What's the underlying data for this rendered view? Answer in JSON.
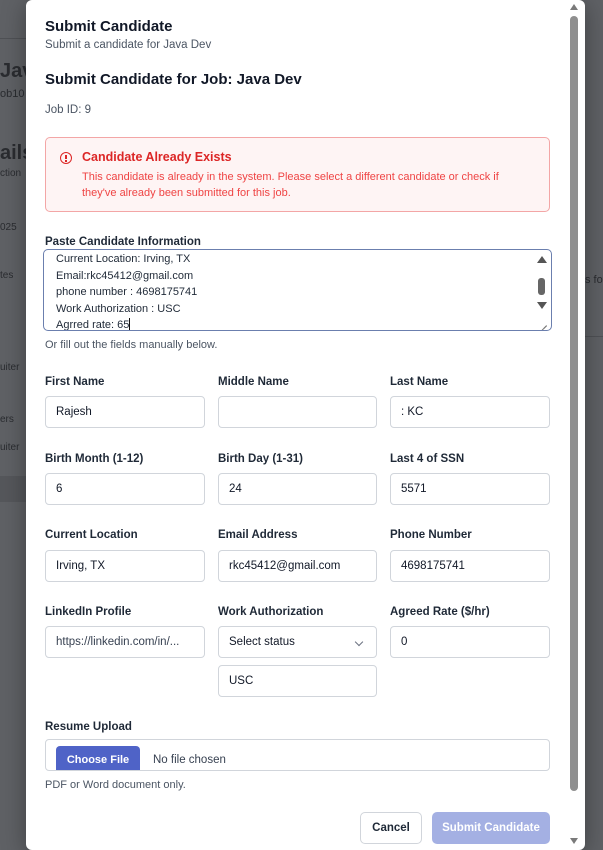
{
  "background": {
    "fragments": [
      "Java",
      "ob10",
      "ails",
      "ction",
      "025",
      "tes",
      "uiter",
      "ers",
      "uiter",
      "s fo"
    ]
  },
  "modal": {
    "title": "Submit Candidate",
    "subtitle": "Submit a candidate for Java Dev",
    "heading": "Submit Candidate for Job: Java Dev",
    "job_id": "Job ID: 9"
  },
  "alert": {
    "icon": "alert-circle-icon",
    "title": "Candidate Already Exists",
    "message": "This candidate is already in the system. Please select a different candidate or check if they've already been submitted for this job.",
    "color": "#dc2626"
  },
  "paste": {
    "label": "Paste Candidate Information",
    "lines": [
      "Current Location: Irving, TX",
      "Email:rkc45412@gmail.com",
      "phone number : 4698175741",
      "Work Authorization : USC",
      "Agrred rate: 65"
    ],
    "hint": "Or fill out the fields manually below."
  },
  "fields": {
    "first_name": {
      "label": "First Name",
      "value": "Rajesh"
    },
    "middle_name": {
      "label": "Middle Name",
      "value": ""
    },
    "last_name": {
      "label": "Last Name",
      "value": ": KC"
    },
    "birth_month": {
      "label": "Birth Month (1-12)",
      "value": "6"
    },
    "birth_day": {
      "label": "Birth Day (1-31)",
      "value": "24"
    },
    "ssn_last4": {
      "label": "Last 4 of SSN",
      "value": "5571"
    },
    "location": {
      "label": "Current Location",
      "value": "Irving, TX"
    },
    "email": {
      "label": "Email Address",
      "value": "rkc45412@gmail.com"
    },
    "phone": {
      "label": "Phone Number",
      "value": "4698175741"
    },
    "linkedin": {
      "label": "LinkedIn Profile",
      "placeholder": "https://linkedin.com/in/..."
    },
    "work_auth": {
      "label": "Work Authorization",
      "select_value": "Select status",
      "value": "USC"
    },
    "rate": {
      "label": "Agreed Rate ($/hr)",
      "value": "0"
    }
  },
  "resume": {
    "label": "Resume Upload",
    "button": "Choose File",
    "status": "No file chosen",
    "hint": "PDF or Word document only."
  },
  "actions": {
    "cancel": "Cancel",
    "submit": "Submit Candidate",
    "submit_color": "#a4b0e3"
  }
}
